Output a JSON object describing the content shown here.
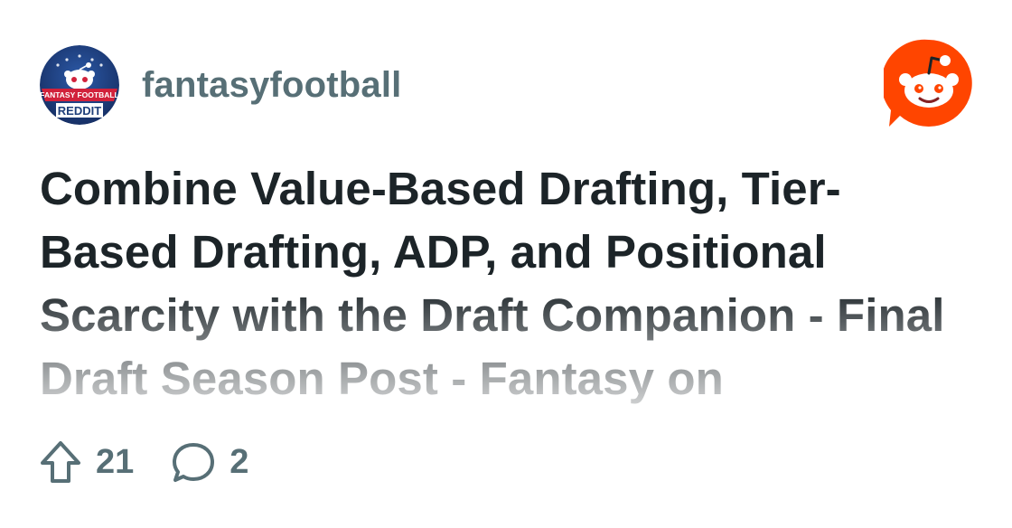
{
  "subreddit": {
    "name": "fantasyfootball",
    "avatar_icon": "fantasy-football-reddit-avatar",
    "avatar_text_top": "FANTASY FOOTBALL",
    "avatar_text_bottom": "REDDIT",
    "avatar_colors": {
      "background": "#1f3f7a",
      "banner": "#d1213b",
      "text": "#ffffff"
    }
  },
  "brand": {
    "logo_icon": "reddit-snoo-logo-icon",
    "color": "#ff4500"
  },
  "post": {
    "title": "Combine Value-Based Drafting, Tier-Based Drafting, ADP, and Positional Scarcity with the Draft Companion - Final Draft Season Post - Fantasy on"
  },
  "stats": {
    "upvotes": "21",
    "upvote_icon": "upvote-arrow-icon",
    "comments": "2",
    "comment_icon": "comment-bubble-icon"
  },
  "colors": {
    "title_text": "#1c2428",
    "meta_text": "#576f76"
  }
}
